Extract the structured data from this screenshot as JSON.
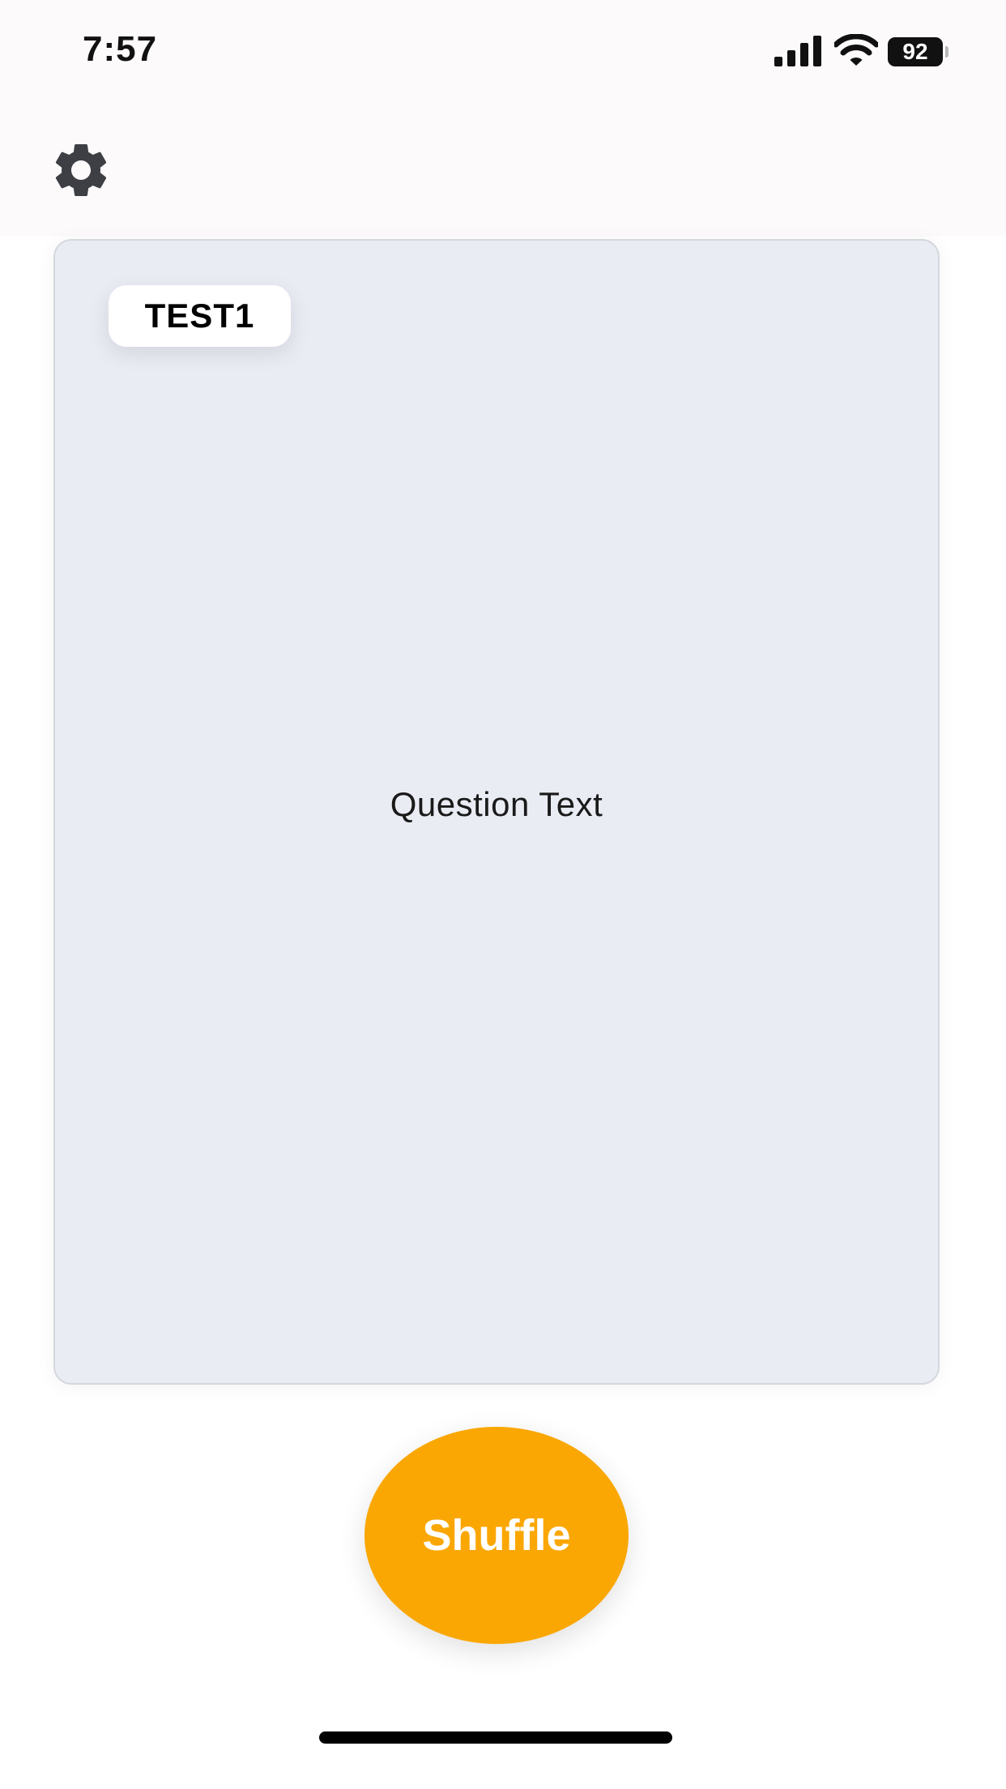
{
  "status_bar": {
    "time": "7:57",
    "battery_level": "92",
    "icons": [
      "cellular-signal-icon",
      "wifi-icon",
      "battery-icon"
    ]
  },
  "toolbar": {
    "settings_icon": "gear-icon"
  },
  "card": {
    "deck_label": "TEST1",
    "question": "Question Text"
  },
  "actions": {
    "shuffle_label": "Shuffle"
  },
  "colors": {
    "accent": "#faa704",
    "card_background": "#e9ecf3",
    "top_background": "#fdfafc"
  }
}
